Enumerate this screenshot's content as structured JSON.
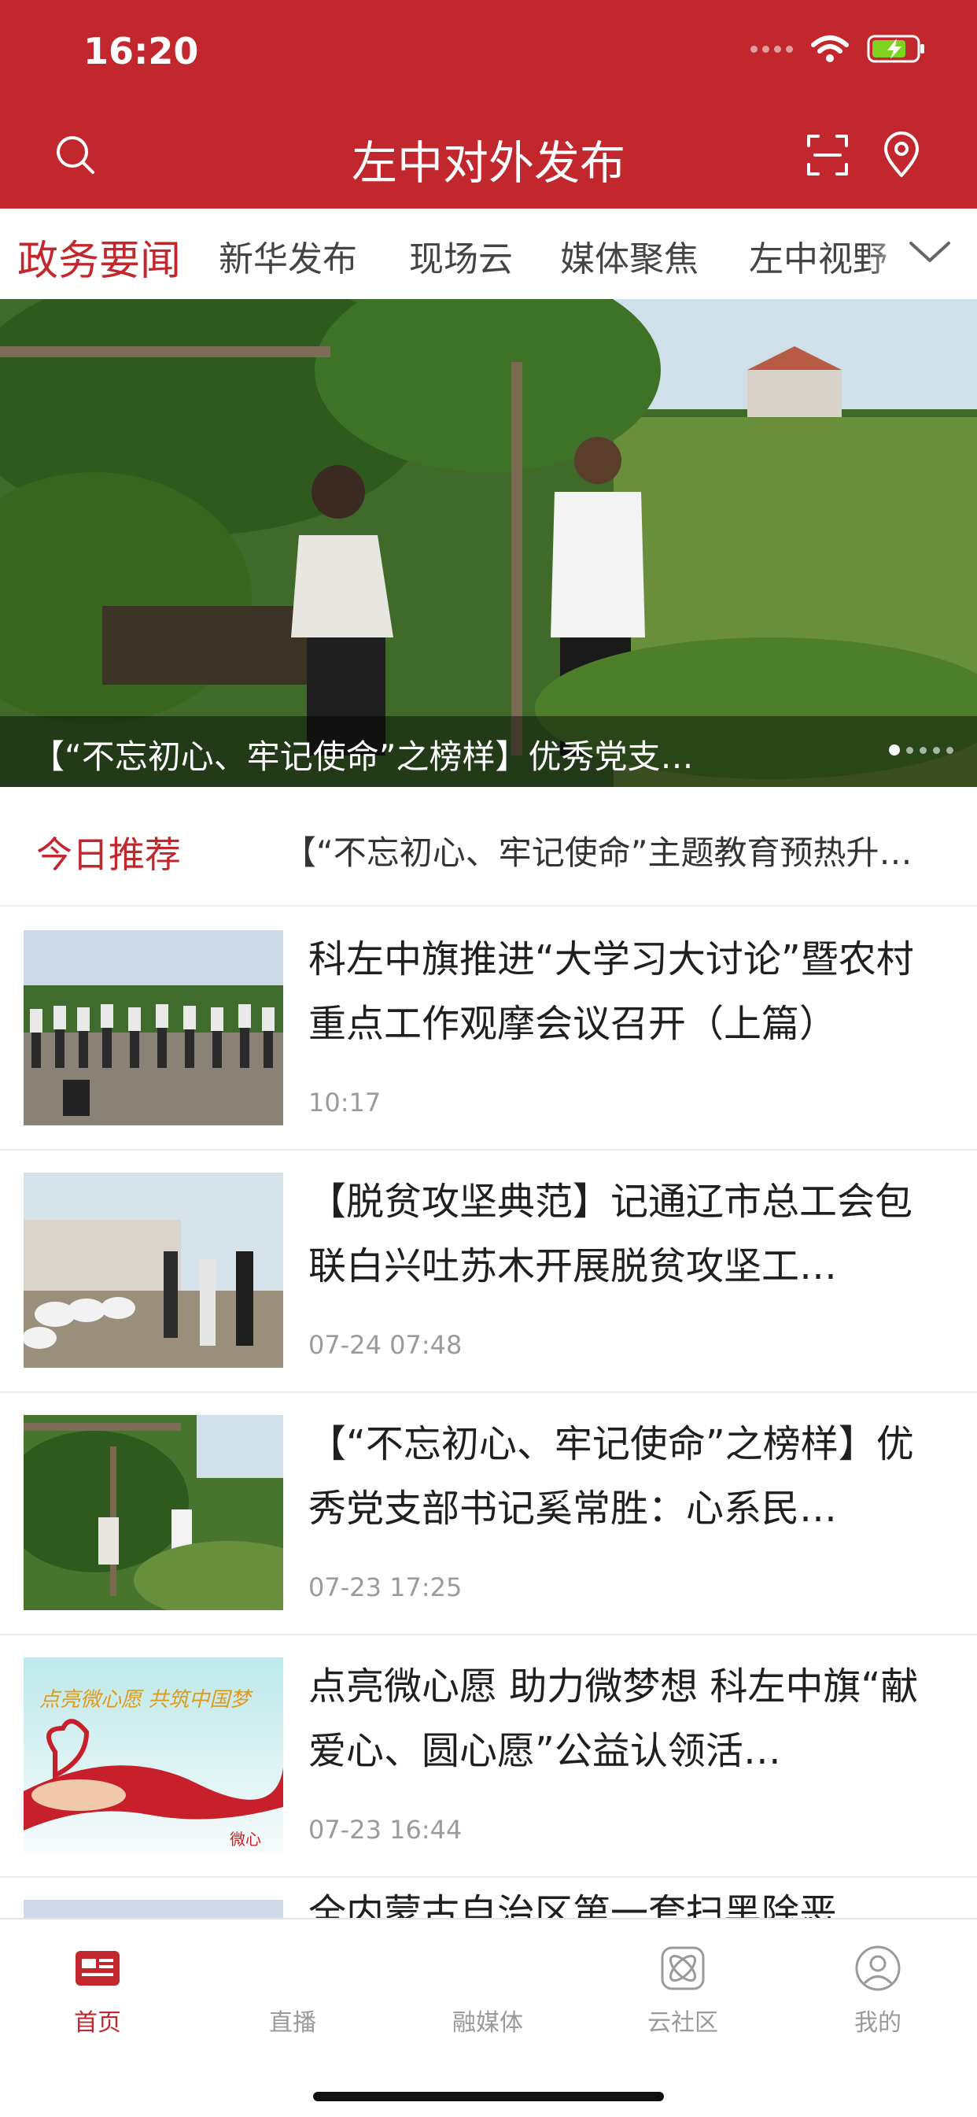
{
  "status_bar": {
    "time": "16:20"
  },
  "header": {
    "title": "左中对外发布",
    "icons": [
      "search-icon",
      "scan-icon",
      "location-pin-icon"
    ]
  },
  "channel_tabs": [
    "政务要闻",
    "新华发布",
    "现场云",
    "媒体聚焦",
    "左中视野"
  ],
  "carousel": {
    "caption": "【“不忘初心、牢记使命”之榜样】优秀党支…",
    "page_count": 5,
    "current_page": 1
  },
  "recommend": {
    "label": "今日推荐",
    "text": "【“不忘初心、牢记使命”主题教育预热升…"
  },
  "news": [
    {
      "title": "科左中旗推进“大学习大讨论”暨农村重点工作观摩会议召开（上篇）",
      "time": "10:17"
    },
    {
      "title": "【脱贫攻坚典范】记通辽市总工会包联白兴吐苏木开展脱贫攻坚工…",
      "time": "07-24 07:48"
    },
    {
      "title": "【“不忘初心、牢记使命”之榜样】优秀党支部书记奚常胜：心系民…",
      "time": "07-23 17:25"
    },
    {
      "title": "点亮微心愿 助力微梦想 科左中旗“献爱心、圆心愿”公益认领活…",
      "time": "07-23 16:44"
    },
    {
      "title": "全内蒙古自治区第一套扫黑除恶",
      "time": ""
    }
  ],
  "thumb_texts": {
    "wish_banner": "点亮微心愿 共筑中国梦",
    "wish_logo": "微心"
  },
  "tabbar": [
    {
      "label": "首页",
      "icon": "home-news-icon",
      "active": true
    },
    {
      "label": "直播",
      "icon": "live-icon",
      "active": false
    },
    {
      "label": "融媒体",
      "icon": "media-icon",
      "active": false
    },
    {
      "label": "云社区",
      "icon": "community-icon",
      "active": false
    },
    {
      "label": "我的",
      "icon": "profile-icon",
      "active": false
    }
  ],
  "colors": {
    "brand_red": "#c1272d",
    "inactive_gray": "#9a9a9a",
    "time_gray": "#9b9b9b"
  }
}
